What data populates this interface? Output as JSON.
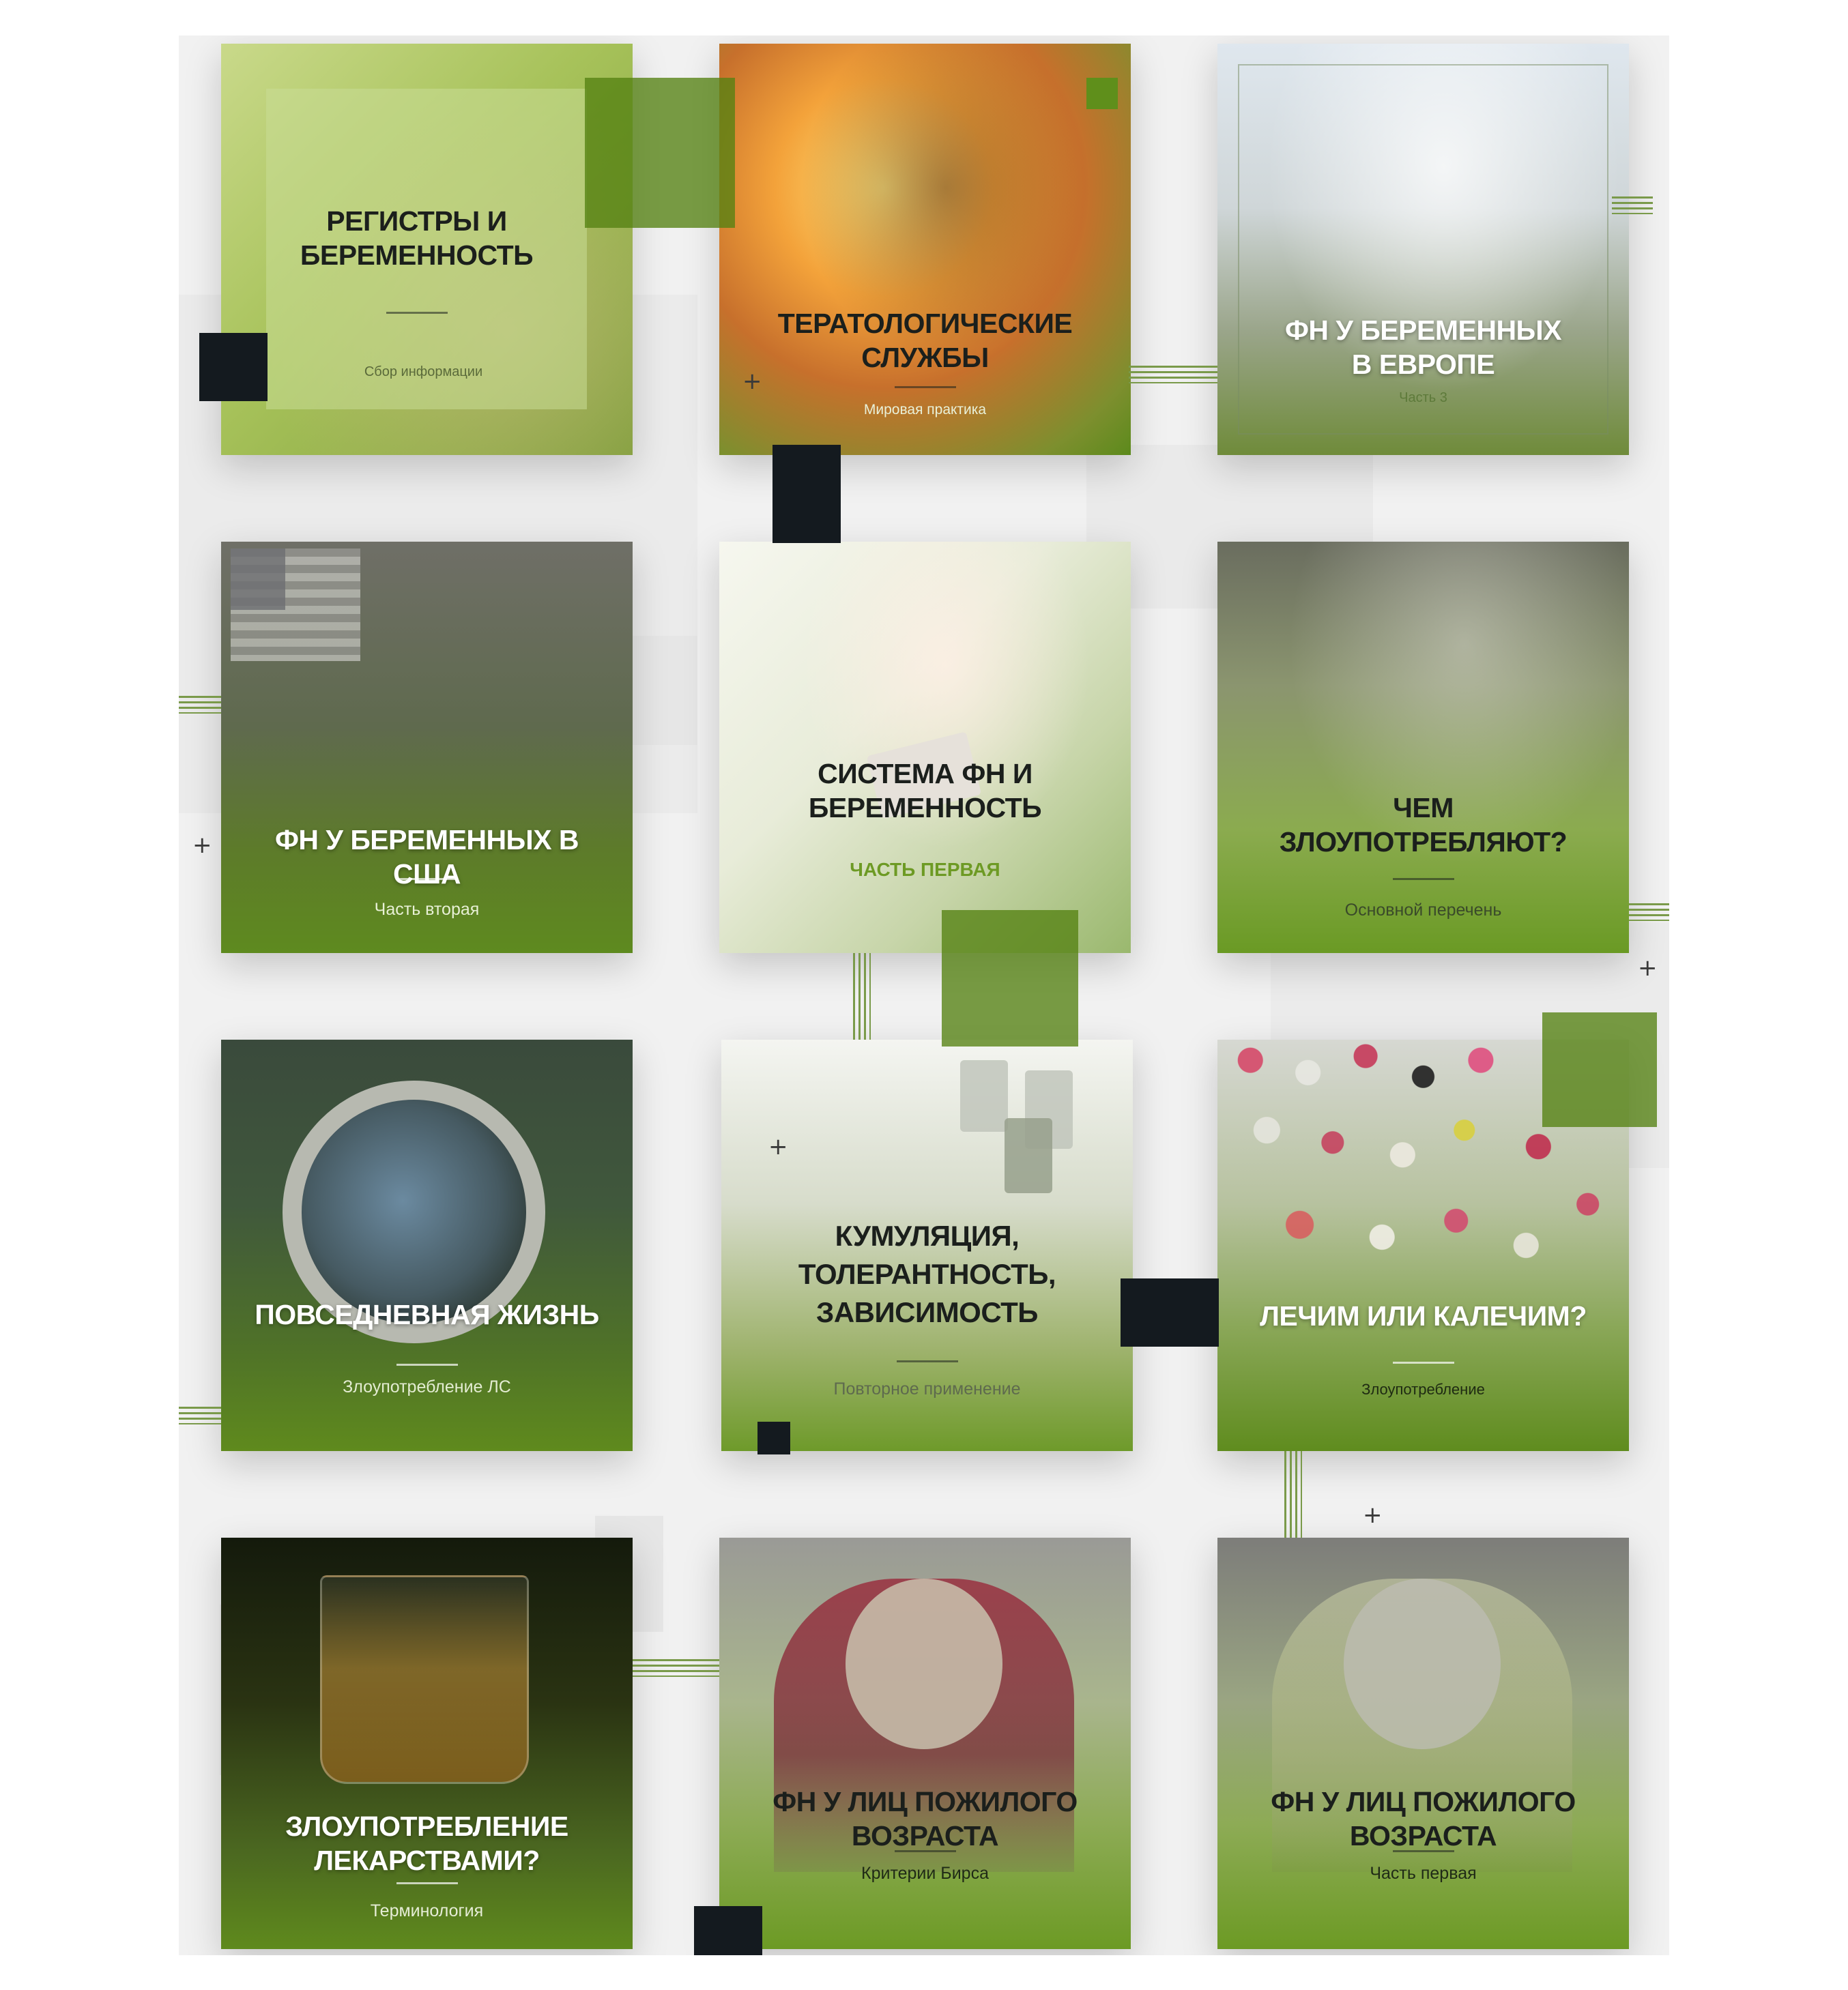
{
  "cards": [
    {
      "title": "Регистры и беременность",
      "subtitle": "Сбор информации"
    },
    {
      "title": "Тератологические службы",
      "subtitle": "Мировая практика"
    },
    {
      "title": "ФН у беременных в Европе",
      "subtitle": "Часть 3"
    },
    {
      "title": "ФН у беременных в США",
      "subtitle": "Часть вторая"
    },
    {
      "title": "Система ФН и беременность",
      "subtitle": "ЧАСТЬ ПЕРВАЯ"
    },
    {
      "title": "Чем злоупотребляют?",
      "subtitle": "Основной перечень"
    },
    {
      "title": "Повседневная жизнь",
      "subtitle": "Злоупотребление ЛС"
    },
    {
      "title": "Кумуляция, толерантность, зависимость",
      "subtitle": "Повторное применение"
    },
    {
      "title": "Лечим или калечим?",
      "subtitle": "Злоупотребление"
    },
    {
      "title": "Злоупотребление лекарствами?",
      "subtitle": "Терминология"
    },
    {
      "title": "ФН у лиц пожилого возраста",
      "subtitle": "Критерии Бирса"
    },
    {
      "title": "ФН у лиц пожилого возраста",
      "subtitle": "Часть первая"
    }
  ],
  "colors": {
    "accent_green": "#5f8f1b",
    "dark_square": "#141a1f",
    "canvas": "#f1f1f1"
  }
}
